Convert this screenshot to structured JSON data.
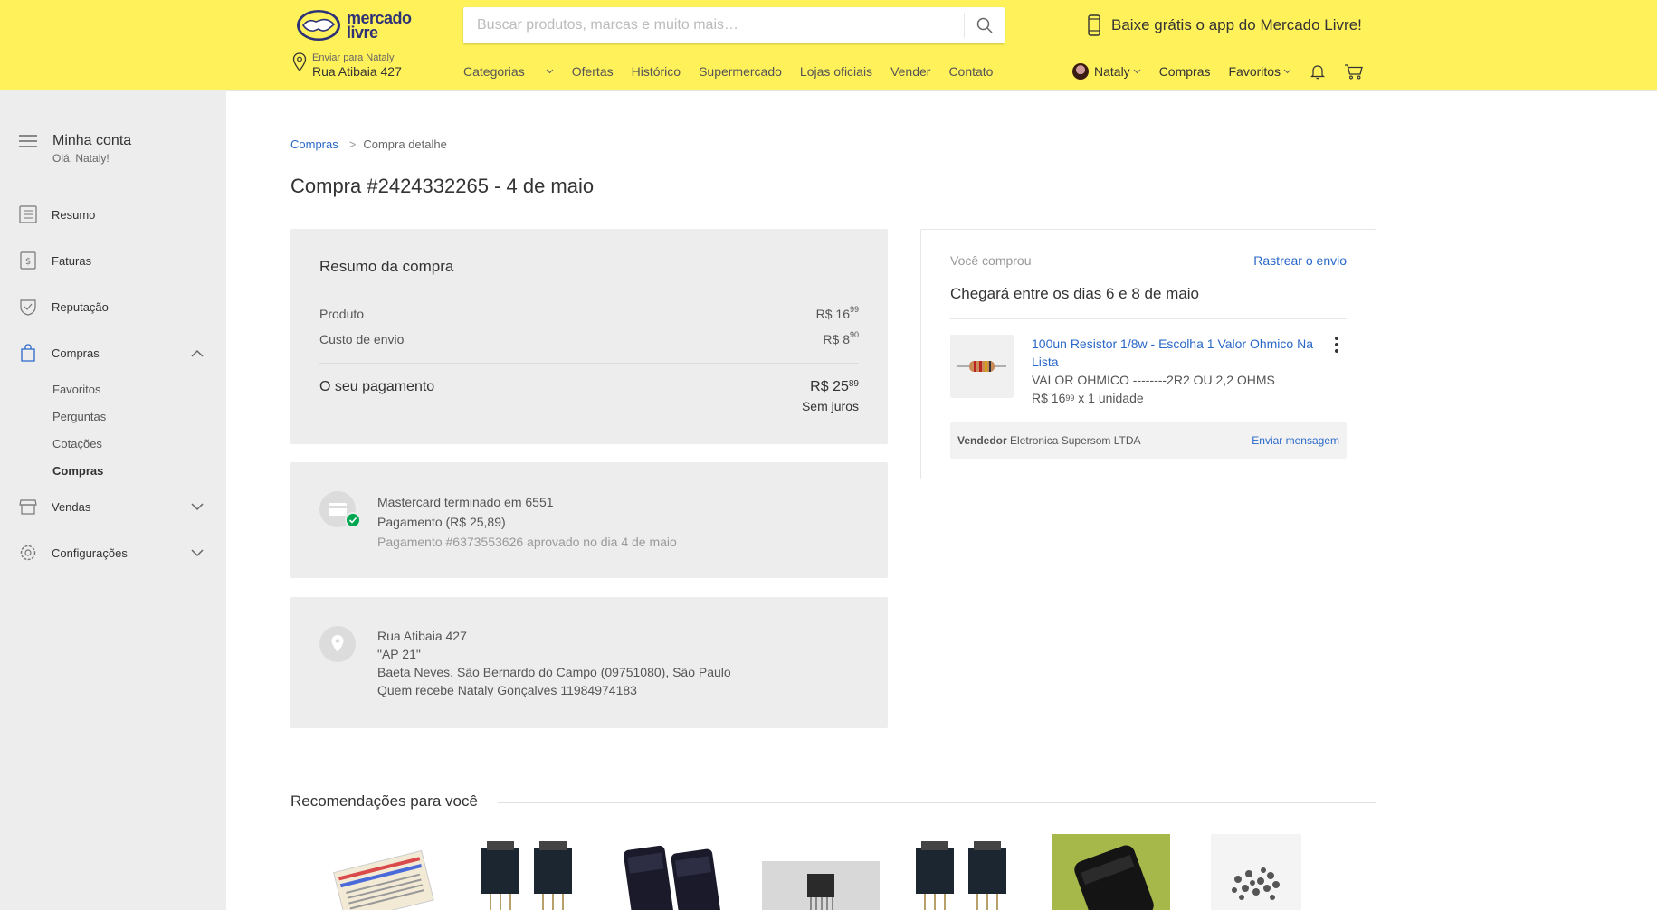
{
  "header": {
    "logo_text_1": "mercado",
    "logo_text_2": "livre",
    "search_placeholder": "Buscar produtos, marcas e muito mais…",
    "app_promo": "Baixe grátis o app do Mercado Livre!",
    "location_label": "Enviar para Nataly",
    "location_address": "Rua Atibaia 427",
    "nav": [
      "Categorias",
      "Ofertas",
      "Histórico",
      "Supermercado",
      "Lojas oficiais",
      "Vender",
      "Contato"
    ],
    "user_name": "Nataly",
    "purchases": "Compras",
    "favorites": "Favoritos"
  },
  "sidebar": {
    "title": "Minha conta",
    "greeting": "Olá, Nataly!",
    "items": {
      "resumo": "Resumo",
      "faturas": "Faturas",
      "reputacao": "Reputação",
      "compras": "Compras",
      "vendas": "Vendas",
      "configuracoes": "Configurações"
    },
    "compras_sub": [
      "Favoritos",
      "Perguntas",
      "Cotações",
      "Compras"
    ]
  },
  "breadcrumb": {
    "link": "Compras",
    "separator": ">",
    "current": "Compra detalhe"
  },
  "page_title": "Compra #2424332265 - 4 de maio",
  "summary": {
    "title": "Resumo da compra",
    "product_label": "Produto",
    "product_price_int": "R$ 16",
    "product_price_cents": "99",
    "shipping_label": "Custo de envio",
    "shipping_price_int": "R$ 8",
    "shipping_price_cents": "90",
    "payment_label": "O seu pagamento",
    "payment_price_int": "R$ 25",
    "payment_price_cents": "89",
    "payment_note": "Sem juros"
  },
  "payment": {
    "card": "Mastercard terminado em 6551",
    "amount": "Pagamento (R$ 25,89)",
    "approval": "Pagamento #6373553626 aprovado no dia 4 de maio"
  },
  "address": {
    "line1": "Rua Atibaia 427",
    "line2": "\"AP 21\"",
    "line3": "Baeta Neves, São Bernardo do Campo (09751080), São Paulo",
    "line4": "Quem recebe Nataly Gonçalves 11984974183"
  },
  "order": {
    "bought_label": "Você comprou",
    "track": "Rastrear o envio",
    "arrival": "Chegará entre os dias 6 e 8 de maio",
    "item_title": "100un Resistor 1/8w - Escolha 1 Valor Ohmico Na Lista",
    "item_variant": "VALOR OHMICO --------2R2 OU 2,2 OHMS",
    "item_price_int": "R$ 16",
    "item_price_cents": "99",
    "item_qty": " x 1 unidade",
    "seller_label": "Vendedor",
    "seller_name": "Eletronica Supersom LTDA",
    "message": "Enviar mensagem"
  },
  "recommendations": {
    "title": "Recomendações para você"
  },
  "colors": {
    "header_bg": "#fff159",
    "link": "#2968c8",
    "success": "#00a650",
    "sidebar_bg": "#ededed"
  }
}
